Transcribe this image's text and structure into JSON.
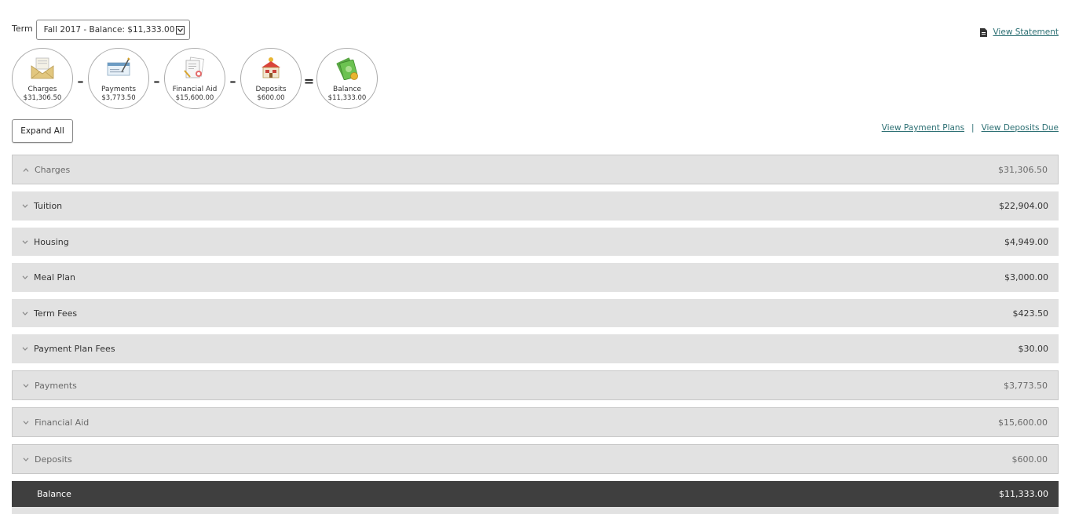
{
  "term": {
    "label": "Term",
    "selected": "Fall 2017 - Balance: $11,333.00"
  },
  "statement_link": "View Statement",
  "summary": [
    {
      "name": "charges",
      "label": "Charges",
      "value": "$31,306.50",
      "icon": "envelope-icon"
    },
    {
      "name": "payments",
      "label": "Payments",
      "value": "$3,773.50",
      "icon": "check-icon"
    },
    {
      "name": "financial-aid",
      "label": "Financial Aid",
      "value": "$15,600.00",
      "icon": "documents-icon"
    },
    {
      "name": "deposits",
      "label": "Deposits",
      "value": "$600.00",
      "icon": "house-icon"
    },
    {
      "name": "balance",
      "label": "Balance",
      "value": "$11,333.00",
      "icon": "money-icon"
    }
  ],
  "operators": [
    "–",
    "–",
    "–",
    "="
  ],
  "expand_all": "Expand All",
  "links": {
    "payment_plans": "View Payment Plans",
    "separator": "|",
    "deposits_due": "View Deposits Due"
  },
  "sections": {
    "charges": {
      "label": "Charges",
      "amount": "$31,306.50"
    },
    "tuition": {
      "label": "Tuition",
      "amount": "$22,904.00"
    },
    "housing": {
      "label": "Housing",
      "amount": "$4,949.00"
    },
    "meal_plan": {
      "label": "Meal Plan",
      "amount": "$3,000.00"
    },
    "term_fees": {
      "label": "Term Fees",
      "amount": "$423.50"
    },
    "payment_plan_fees": {
      "label": "Payment Plan Fees",
      "amount": "$30.00"
    },
    "payments": {
      "label": "Payments",
      "amount": "$3,773.50"
    },
    "financial_aid": {
      "label": "Financial Aid",
      "amount": "$15,600.00"
    },
    "deposits": {
      "label": "Deposits",
      "amount": "$600.00"
    },
    "balance": {
      "label": "Balance",
      "amount": "$11,333.00"
    }
  },
  "colors": {
    "link": "#2c6f73",
    "bar_bg": "#e2e2e2",
    "total_bg": "#3f3f3f"
  }
}
